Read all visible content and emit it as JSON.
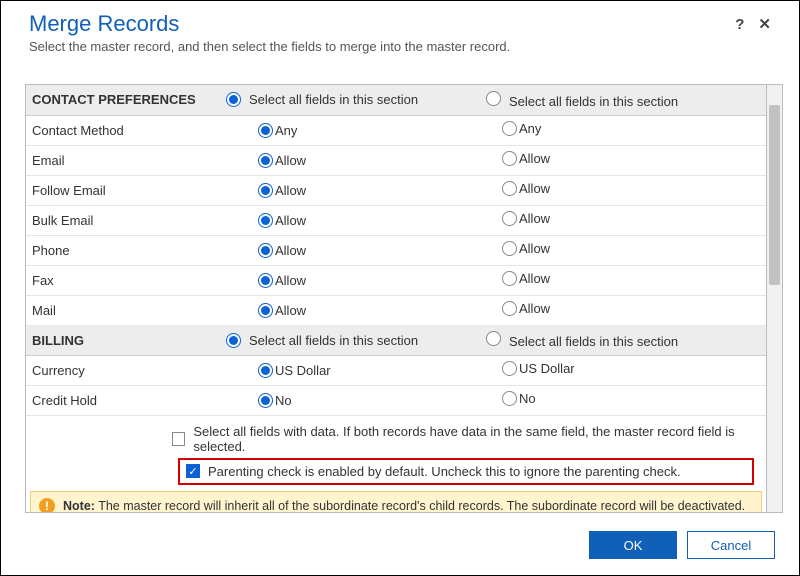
{
  "header": {
    "title": "Merge Records",
    "subtitle": "Select the master record, and then select the fields to merge into the master record."
  },
  "selectAllSectionLabel": "Select all fields in this section",
  "sections": [
    {
      "key": "contact_prefs",
      "label": "CONTACT PREFERENCES",
      "rows": [
        {
          "label": "Contact Method",
          "a": "Any",
          "b": "Any"
        },
        {
          "label": "Email",
          "a": "Allow",
          "b": "Allow"
        },
        {
          "label": "Follow Email",
          "a": "Allow",
          "b": "Allow"
        },
        {
          "label": "Bulk Email",
          "a": "Allow",
          "b": "Allow"
        },
        {
          "label": "Phone",
          "a": "Allow",
          "b": "Allow"
        },
        {
          "label": "Fax",
          "a": "Allow",
          "b": "Allow"
        },
        {
          "label": "Mail",
          "a": "Allow",
          "b": "Allow"
        }
      ]
    },
    {
      "key": "billing",
      "label": "BILLING",
      "rows": [
        {
          "label": "Currency",
          "a": "US Dollar",
          "b": "US Dollar"
        },
        {
          "label": "Credit Hold",
          "a": "No",
          "b": "No"
        }
      ]
    }
  ],
  "checks": {
    "selectAllWithData": "Select all fields with data. If both records have data in the same field, the master record field is selected.",
    "parentingCheck": "Parenting check is enabled by default. Uncheck this to ignore the parenting check."
  },
  "note": {
    "label": "Note:",
    "text": "The master record will inherit all of the subordinate record's child records. The subordinate record will be deactivated."
  },
  "buttons": {
    "ok": "OK",
    "cancel": "Cancel"
  }
}
